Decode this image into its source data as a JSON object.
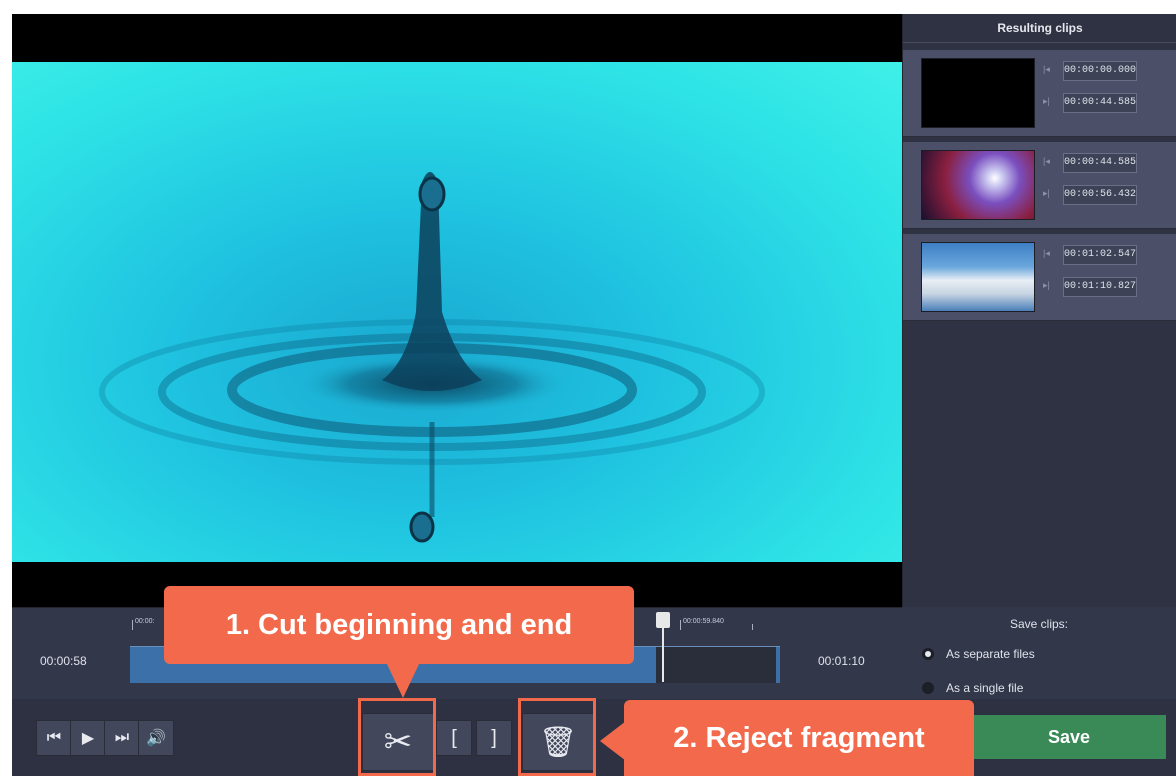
{
  "panel": {
    "title": "Resulting clips",
    "clips": [
      {
        "start": "00:00:00.000",
        "end": "00:00:44.585",
        "thumb": "black"
      },
      {
        "start": "00:00:44.585",
        "end": "00:00:56.432",
        "thumb": "nebula"
      },
      {
        "start": "00:01:02.547",
        "end": "00:01:10.827",
        "thumb": "clouds"
      }
    ]
  },
  "timeline": {
    "start_label": "00:00:58",
    "end_label": "00:01:10",
    "tick_left": "00:00:",
    "tick_right": "00:00:59.840"
  },
  "save_options": {
    "title": "Save clips:",
    "separate": "As separate files",
    "single": "As a single file",
    "selected": "separate"
  },
  "controls": {
    "prev_icon": "skip-back-icon",
    "play_icon": "play-icon",
    "next_icon": "skip-forward-icon",
    "volume_icon": "volume-icon",
    "cut_icon": "scissors-icon",
    "mark_in_icon": "bracket-left-icon",
    "mark_out_icon": "bracket-right-icon",
    "delete_icon": "trash-icon",
    "save_label": "Save"
  },
  "callouts": {
    "cut": "1. Cut beginning and end",
    "reject": "2. Reject fragment"
  },
  "colors": {
    "accent": "#f26a4b",
    "save": "#3a8a57",
    "track": "#3b71a8"
  }
}
